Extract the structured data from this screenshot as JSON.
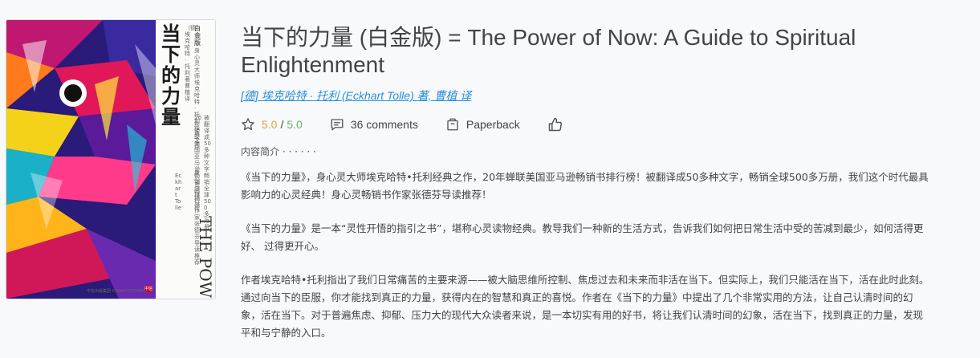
{
  "book": {
    "title": "当下的力量 (白金版) = The Power of Now: A Guide to Spiritual Enlightenment",
    "author_line": "[德] 埃克哈特 · 托利 (Eckhart Tolle) 著, 曹植 译",
    "rating": "5.0",
    "rating_separator": "/",
    "rating_max": "5.0",
    "comments": "36 comments",
    "format": "Paperback"
  },
  "icons": {
    "rating": "star-icon",
    "comments": "comment-icon",
    "format": "book-icon",
    "like": "thumbs-up-icon"
  },
  "colors": {
    "link": "#2b8fd6",
    "rating": "#e0a431",
    "rating_max": "#6db36d"
  },
  "cover": {
    "title_cn": "当下的力量",
    "edition": "白金版",
    "title_en": "THE POWER OF NOW",
    "author_small": "〔德〕埃克哈特·托利 著 曹植 译",
    "tagline": "身心灵大师 埃克哈特·托利经典之作",
    "blurb_a": "20年蝉联美国亚马逊畅销书排行榜",
    "blurb_b": "被翻译成50多种文字 畅销全球500多万册",
    "blurb_c": "身心灵畅销书作家 张德芬导读推荐",
    "author_en": "Eckhart Tolle",
    "publisher": "中信出版集团 CHINACITICPRESS",
    "logo": "中信"
  },
  "description": {
    "heading": "内容简介 · · · · · ·",
    "paragraphs": [
      "《当下的力量》，身心灵大师埃克哈特•托利经典之作，20年蝉联美国亚马逊畅销书排行榜！被翻译成50多种文字，畅销全球500多万册，我们这个时代最具影响力的心灵经典！身心灵畅销书作家张德芬导读推荐！",
      "《当下的力量》是一本“灵性开悟的指引之书”，堪称心灵读物经典。教导我们一种新的生活方式，告诉我们如何把日常生活中受的苦减到最少，如何活得更好、 过得更开心。",
      "作者埃克哈特•托利指出了我们日常痛苦的主要来源——被大脑思维所控制、焦虑过去和未来而非活在当下。但实际上，我们只能活在当下，活在此时此刻。通过向当下的臣服，你才能找到真正的力量，获得内在的智慧和真正的喜悦。作者在《当下的力量》中提出了几个非常实用的方法，让自己认清时间的幻象，活在当下。对于普遍焦虑、抑郁、压力大的现代大众读者来说，是一本切实有用的好书，将让我们认清时间的幻象，活在当下，找到真正的力量，发现平和与宁静的入口。"
    ]
  }
}
